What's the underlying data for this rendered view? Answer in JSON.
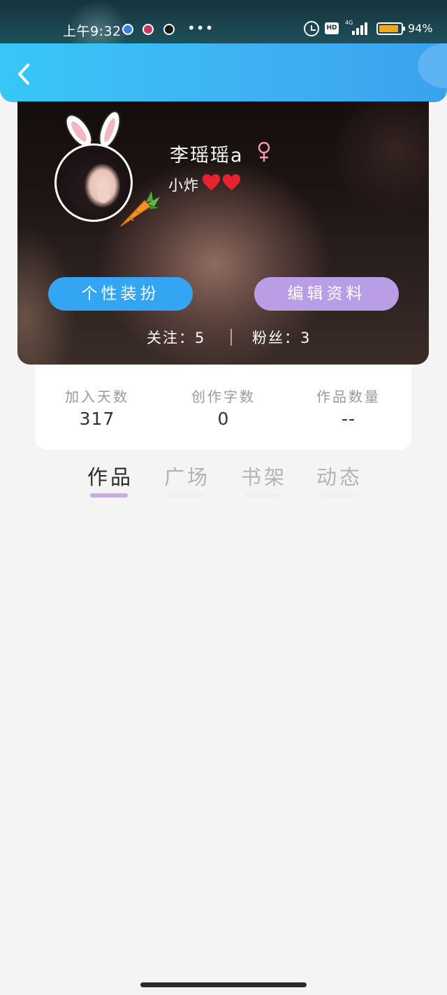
{
  "status_bar": {
    "time": "上午9:32",
    "more": "•••",
    "hd": "HD",
    "network": "4G",
    "battery_pct": "94%",
    "battery_level": 0.94
  },
  "header": {
    "back_icon": "chevron-left-icon",
    "gradient_colors": [
      "#37c7f6",
      "#3aa2ee"
    ]
  },
  "profile": {
    "username": "李瑶瑶a",
    "gender_icon": "female-symbol-icon",
    "bio": "小炸",
    "bio_emoji": [
      "heart-icon",
      "heart-icon"
    ],
    "buttons": {
      "dress_up": "个性装扮",
      "edit_profile": "编辑资料"
    },
    "following": "关注：5",
    "fans": "粉丝：3"
  },
  "stats": [
    {
      "label": "加入天数",
      "value": "317"
    },
    {
      "label": "创作字数",
      "value": "0"
    },
    {
      "label": "作品数量",
      "value": "--"
    }
  ],
  "tabs": [
    {
      "label": "作品",
      "active": true
    },
    {
      "label": "广场",
      "active": false
    },
    {
      "label": "书架",
      "active": false
    },
    {
      "label": "动态",
      "active": false
    }
  ],
  "colors": {
    "dress_up_button": "#33a5f3",
    "edit_button": "#b99ee5",
    "active_tab_indicator": "#c4aee5",
    "gender_icon": "#f19bb0",
    "heart": "#e8232f"
  }
}
